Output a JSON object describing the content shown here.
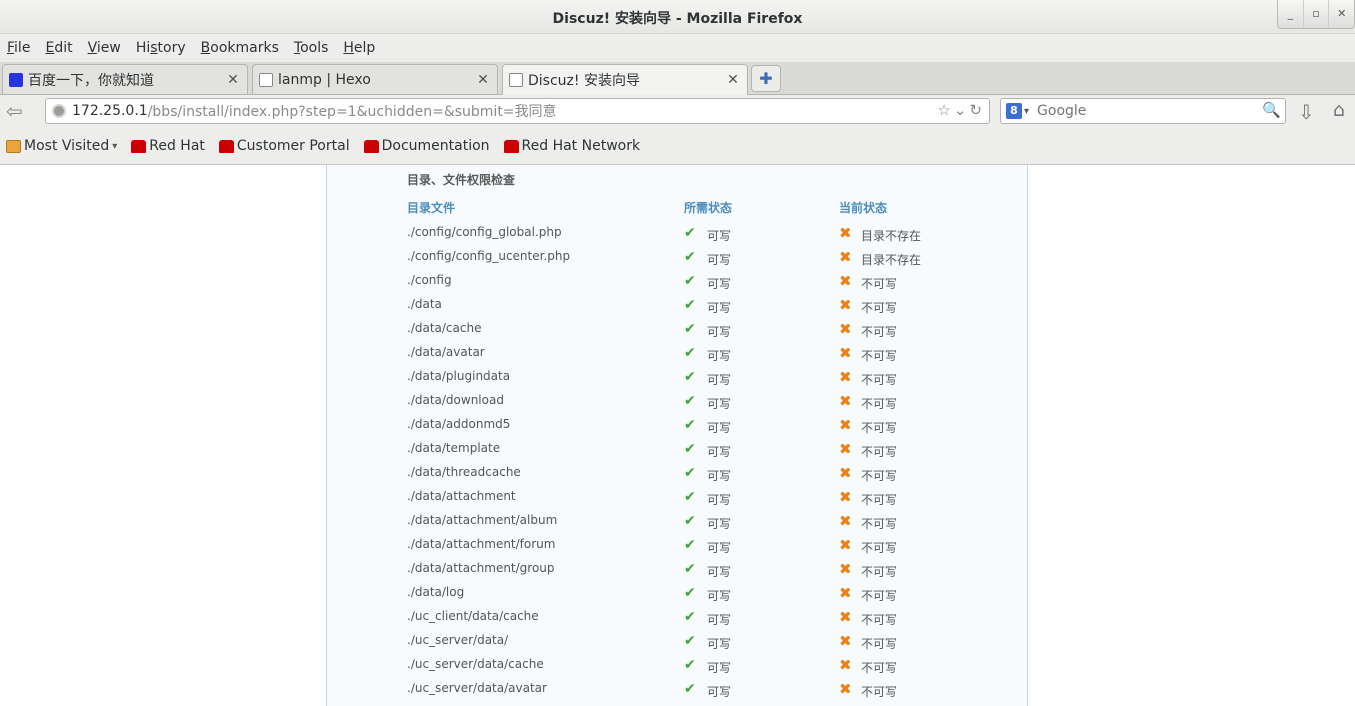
{
  "window": {
    "title": "Discuz! 安装向导 - Mozilla Firefox",
    "controls": [
      "_",
      "▫",
      "✕"
    ]
  },
  "menu": [
    {
      "label": "File",
      "u": "F",
      "rest": "ile"
    },
    {
      "label": "Edit",
      "u": "E",
      "rest": "dit"
    },
    {
      "label": "View",
      "u": "V",
      "rest": "iew"
    },
    {
      "label": "History",
      "u": "",
      "pre": "Hi",
      "mid": "s",
      "post": "tory"
    },
    {
      "label": "Bookmarks",
      "u": "B",
      "rest": "ookmarks"
    },
    {
      "label": "Tools",
      "u": "T",
      "rest": "ools"
    },
    {
      "label": "Help",
      "u": "H",
      "rest": "elp"
    }
  ],
  "tabs": [
    {
      "label": "百度一下，你就知道",
      "active": false
    },
    {
      "label": "lanmp | Hexo",
      "active": false
    },
    {
      "label": "Discuz! 安装向导",
      "active": true
    }
  ],
  "nav": {
    "url_host": "172.25.0.1",
    "url_path": "/bbs/install/index.php?step=1&uchidden=&submit=我同意",
    "search_placeholder": "Google"
  },
  "bookmarks": [
    {
      "label": "Most Visited",
      "icon": "folder-icon"
    },
    {
      "label": "Red Hat",
      "icon": "redhat-icon"
    },
    {
      "label": "Customer Portal",
      "icon": "redhat-icon"
    },
    {
      "label": "Documentation",
      "icon": "redhat-icon"
    },
    {
      "label": "Red Hat Network",
      "icon": "redhat-icon"
    }
  ],
  "page": {
    "section_title": "目录、文件权限检查",
    "headers": {
      "path": "目录文件",
      "required": "所需状态",
      "current": "当前状态"
    },
    "rows": [
      {
        "path": "./config/config_global.php",
        "required": "可写",
        "current": "目录不存在"
      },
      {
        "path": "./config/config_ucenter.php",
        "required": "可写",
        "current": "目录不存在"
      },
      {
        "path": "./config",
        "required": "可写",
        "current": "不可写"
      },
      {
        "path": "./data",
        "required": "可写",
        "current": "不可写"
      },
      {
        "path": "./data/cache",
        "required": "可写",
        "current": "不可写"
      },
      {
        "path": "./data/avatar",
        "required": "可写",
        "current": "不可写"
      },
      {
        "path": "./data/plugindata",
        "required": "可写",
        "current": "不可写"
      },
      {
        "path": "./data/download",
        "required": "可写",
        "current": "不可写"
      },
      {
        "path": "./data/addonmd5",
        "required": "可写",
        "current": "不可写"
      },
      {
        "path": "./data/template",
        "required": "可写",
        "current": "不可写"
      },
      {
        "path": "./data/threadcache",
        "required": "可写",
        "current": "不可写"
      },
      {
        "path": "./data/attachment",
        "required": "可写",
        "current": "不可写"
      },
      {
        "path": "./data/attachment/album",
        "required": "可写",
        "current": "不可写"
      },
      {
        "path": "./data/attachment/forum",
        "required": "可写",
        "current": "不可写"
      },
      {
        "path": "./data/attachment/group",
        "required": "可写",
        "current": "不可写"
      },
      {
        "path": "./data/log",
        "required": "可写",
        "current": "不可写"
      },
      {
        "path": "./uc_client/data/cache",
        "required": "可写",
        "current": "不可写"
      },
      {
        "path": "./uc_server/data/",
        "required": "可写",
        "current": "不可写"
      },
      {
        "path": "./uc_server/data/cache",
        "required": "可写",
        "current": "不可写"
      },
      {
        "path": "./uc_server/data/avatar",
        "required": "可写",
        "current": "不可写"
      }
    ]
  },
  "colors": {
    "ok": "#3da631",
    "error": "#f07f0b",
    "header": "#4d8cbe"
  }
}
